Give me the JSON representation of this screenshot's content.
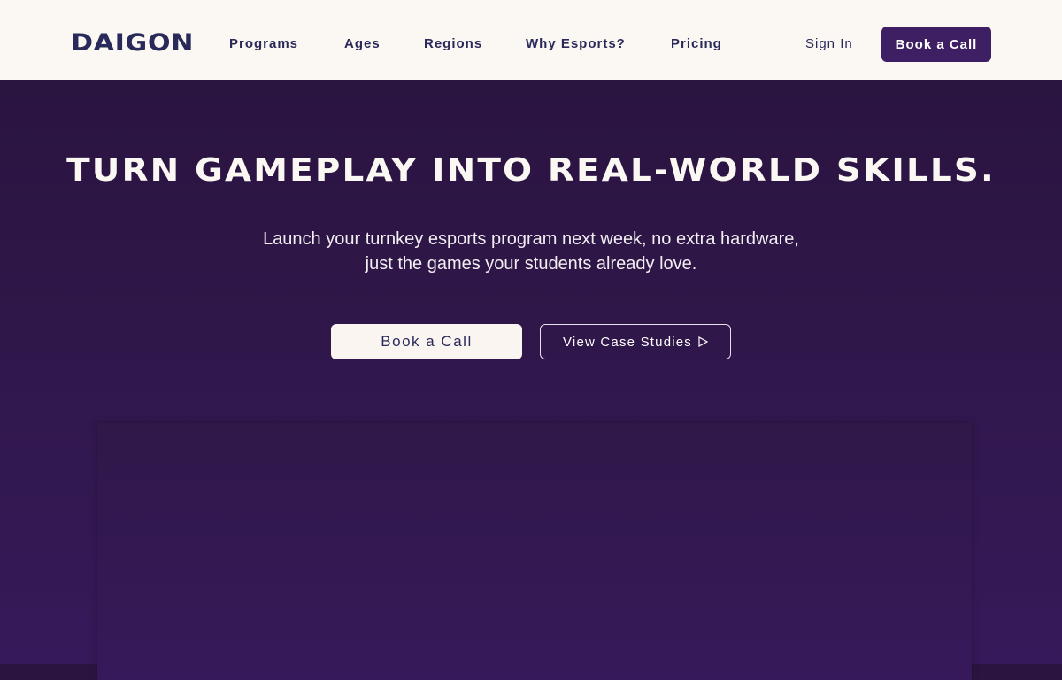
{
  "header": {
    "logo": "DAIGON",
    "nav": [
      "Programs",
      "Ages",
      "Regions",
      "Why Esports?",
      "Pricing"
    ],
    "sign_in": "Sign In",
    "cta": "Book a Call"
  },
  "hero": {
    "headline": "TURN GAMEPLAY INTO REAL-WORLD SKILLS.",
    "subtitle_line1": "Launch your turnkey esports program next week, no extra hardware,",
    "subtitle_line2": "just the games your students already love.",
    "primary_cta": "Book a Call",
    "secondary_cta": "View Case Studies"
  },
  "icons": {
    "secondary_cta_icon": "play-outline-icon"
  },
  "colors": {
    "nav_bg": "#fbf7f3",
    "brand_purple": "#3f1f63",
    "hero_bg": "#2f1749",
    "text_dark": "#2a2a5a"
  }
}
